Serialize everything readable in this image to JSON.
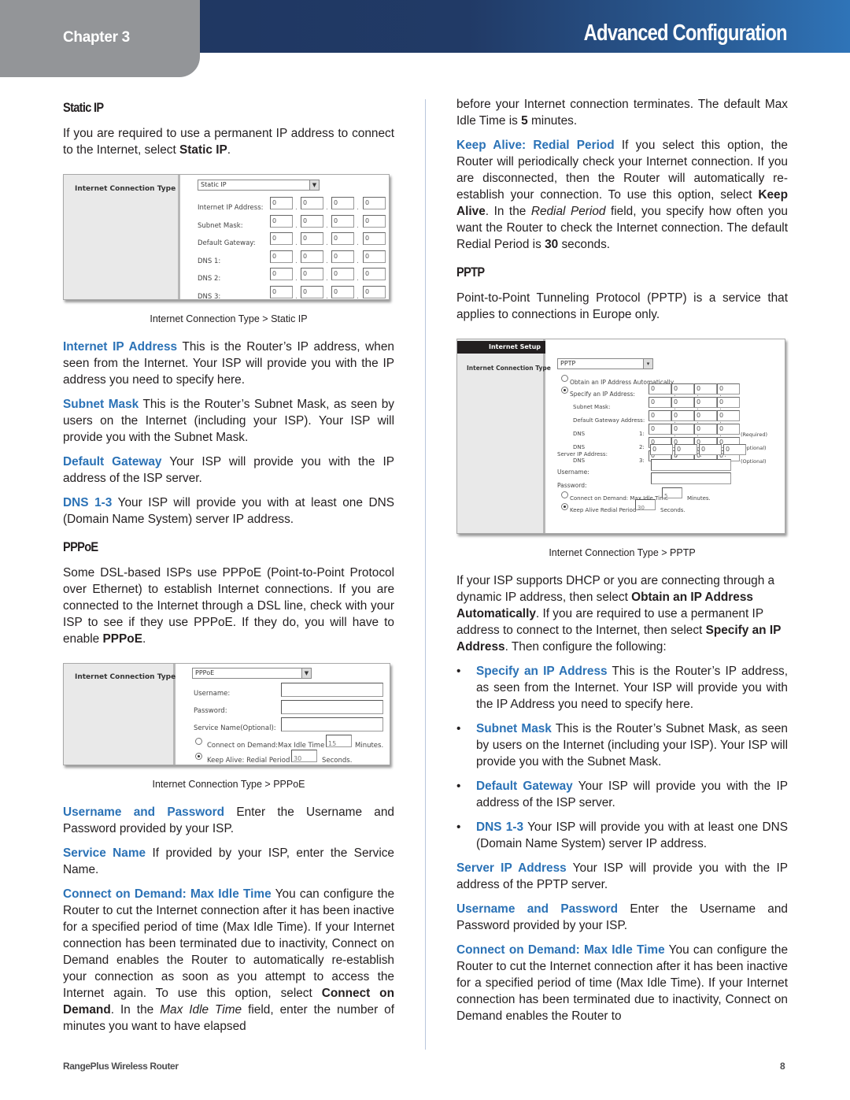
{
  "header": {
    "chapter": "Chapter 3",
    "title": "Advanced Configuration",
    "colors": {
      "bar_dark": "#1f3660",
      "bar_light": "#2f74b8",
      "chapter_tab": "#939598",
      "term_blue": "#2b72b6"
    }
  },
  "left": {
    "static_ip": {
      "heading": "Static IP",
      "intro_pre": "If you are required to use a permanent IP address to connect to the Internet, select ",
      "intro_bold": "Static IP",
      "intro_post": ".",
      "screenshot": {
        "label": "Internet Connection Type",
        "select_value": "Static IP",
        "rows": [
          {
            "label": "Internet IP Address:",
            "values": [
              "0",
              "0",
              "0",
              "0"
            ]
          },
          {
            "label": "Subnet Mask:",
            "values": [
              "0",
              "0",
              "0",
              "0"
            ]
          },
          {
            "label": "Default Gateway:",
            "values": [
              "0",
              "0",
              "0",
              "0"
            ]
          },
          {
            "label": "DNS 1:",
            "values": [
              "0",
              "0",
              "0",
              "0"
            ]
          },
          {
            "label": "DNS 2:",
            "values": [
              "0",
              "0",
              "0",
              "0"
            ]
          },
          {
            "label": "DNS 3:",
            "values": [
              "0",
              "0",
              "0",
              "0"
            ]
          }
        ]
      },
      "caption": "Internet Connection Type > Static IP",
      "items": [
        {
          "term": "Internet IP Address",
          "text": "  This is the Router’s IP address, when seen from the Internet. Your ISP will provide you with the IP address you need to specify here."
        },
        {
          "term": "Subnet Mask",
          "text": "  This is the Router’s Subnet Mask, as seen by users on the Internet (including your ISP). Your ISP will provide you with the Subnet Mask."
        },
        {
          "term": "Default Gateway",
          "text": "  Your ISP will provide you with the IP address of the ISP server."
        },
        {
          "term": "DNS 1-3",
          "text": "  Your ISP will provide you with at least one DNS (Domain Name System) server IP address."
        }
      ]
    },
    "pppoe": {
      "heading": "PPPoE",
      "intro_pre": "Some DSL-based ISPs use PPPoE (Point-to-Point Protocol over Ethernet) to establish Internet connections. If you are connected to the Internet through a DSL line, check with your ISP to see if they use PPPoE. If they do, you will have to enable ",
      "intro_bold": "PPPoE",
      "intro_post": ".",
      "screenshot": {
        "label": "Internet Connection Type",
        "select_value": "PPPoE",
        "username_label": "Username:",
        "password_label": "Password:",
        "service_label": "Service Name(Optional):",
        "cod_label": "Connect on Demand:Max Idle Time",
        "cod_value": "15",
        "cod_unit": "Minutes.",
        "ka_label": "Keep Alive: Redial Period",
        "ka_value": "30",
        "ka_unit": "Seconds.",
        "selected_mode": "keep_alive"
      },
      "caption": "Internet Connection Type > PPPoE",
      "items": [
        {
          "term": "Username and Password",
          "text": " Enter the Username and Password provided by your ISP."
        },
        {
          "term": "Service Name",
          "text": "  If provided by your ISP, enter the Service Name."
        }
      ],
      "cod": {
        "term": "Connect on Demand: Max Idle Time",
        "t1": "  You can configure the Router to cut the Internet connection after it has been inactive for a specified period of time (Max Idle Time). If your Internet connection has been terminated due to inactivity, Connect on Demand enables the Router to automatically re-establish your connection as soon as you attempt to access the Internet again. To use this option, select ",
        "b1": "Connect on Demand",
        "t2": ". In the ",
        "i1": "Max Idle Time",
        "t3": " field, enter the number of minutes you want to have elapsed"
      }
    }
  },
  "right": {
    "cont": {
      "t1": "before your Internet connection terminates. The default Max Idle Time is ",
      "b1": "5",
      "t2": " minutes."
    },
    "keep_alive": {
      "term": "Keep Alive: Redial Period",
      "t1": " If you select this option, the Router will periodically check your Internet connection. If you are disconnected, then the Router will automatically re-establish your connection. To use this option, select ",
      "b1": "Keep Alive",
      "t2": ". In the ",
      "i1": "Redial Period",
      "t3": " field, you specify how often you want the Router to check the Internet connection. The default Redial Period is ",
      "b2": "30",
      "t4": " seconds."
    },
    "pptp": {
      "heading": "PPTP",
      "intro": "Point-to-Point Tunneling Protocol (PPTP) is a service that applies to connections in Europe only.",
      "screenshot": {
        "section_title": "Internet Setup",
        "label": "Internet Connection Type",
        "select_value": "PPTP",
        "obtain_label": "Obtain an IP Address Automatically",
        "specify_label": "Specify an IP Address:",
        "rows": [
          {
            "label": "Subnet Mask:",
            "num": "",
            "values": [
              "0",
              "0",
              "0",
              "0"
            ],
            "note": ""
          },
          {
            "label": "Default Gateway Address:",
            "num": "",
            "values": [
              "0",
              "0",
              "0",
              "0"
            ],
            "note": ""
          },
          {
            "label": "DNS",
            "num": "1:",
            "values": [
              "0",
              "0",
              "0",
              "0"
            ],
            "note": "(Required)"
          },
          {
            "label": "DNS",
            "num": "2:",
            "values": [
              "0",
              "0",
              "0",
              "0"
            ],
            "note": "(Optional)"
          },
          {
            "label": "DNS",
            "num": "3:",
            "values": [
              "0",
              "0",
              "0",
              "0"
            ],
            "note": "(Optional)"
          }
        ],
        "specify_values": [
          "0",
          "0",
          "0",
          "0"
        ],
        "server_label": "Server IP Address:",
        "server_values": [
          "0",
          "0",
          "0",
          "0"
        ],
        "username_label": "Username:",
        "password_label": "Password:",
        "cod_label": "Connect on Demand: Max Idle Time",
        "cod_value": "5",
        "cod_unit": "Minutes.",
        "ka_label": "Keep Alive Redial Period",
        "ka_value": "30",
        "ka_unit": "Seconds.",
        "selected_ip_mode": "specify",
        "selected_mode": "keep_alive"
      },
      "caption": "Internet Connection Type > PPTP",
      "dhcp": {
        "t1": "If your ISP supports DHCP or you are connecting through a dynamic IP address, then select ",
        "b1": "Obtain an IP Address Automatically",
        "t2": ". If you are required to use a permanent IP address to connect to the Internet, then select ",
        "b2": "Specify an IP Address",
        "t3": ". Then configure the following:"
      },
      "bullets": [
        {
          "term": "Specify an IP Address",
          "text": "  This is the Router’s IP address, as seen from the Internet. Your ISP will provide you with the IP Address you need to specify here."
        },
        {
          "term": "Subnet Mask",
          "text": " This is the Router’s Subnet Mask, as seen by users on the Internet (including your ISP). Your ISP will provide you with the Subnet Mask."
        },
        {
          "term": "Default Gateway",
          "text": "  Your ISP will provide you with the IP address of the ISP server."
        },
        {
          "term": "DNS 1-3",
          "text": "  Your ISP will provide you with at least one DNS (Domain Name System) server IP address."
        }
      ],
      "items": [
        {
          "term": "Server IP Address",
          "text": "  Your ISP will provide you with the IP address of the PPTP server."
        },
        {
          "term": "Username and Password",
          "text": " Enter the Username and Password provided by your ISP."
        },
        {
          "term": "Connect on Demand: Max Idle Time",
          "text": "  You can configure the Router to cut the Internet connection after it has been inactive for a specified period of time (Max Idle Time). If your Internet connection has been terminated due to inactivity, Connect on Demand enables the Router to"
        }
      ]
    }
  },
  "footer": {
    "product": "RangePlus Wireless Router",
    "page": "8"
  }
}
